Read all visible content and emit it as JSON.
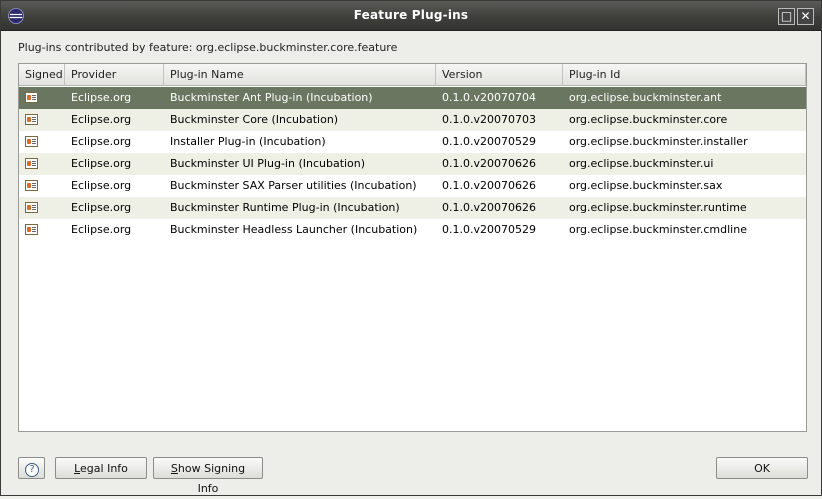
{
  "window": {
    "title": "Feature Plug-ins",
    "maximize_glyph": "□",
    "close_glyph": "✕"
  },
  "feature_label": "Plug-ins contributed by feature: org.eclipse.buckminster.core.feature",
  "table": {
    "columns": [
      "Signed",
      "Provider",
      "Plug-in Name",
      "Version",
      "Plug-in Id"
    ],
    "selected_row": 0,
    "rows": [
      {
        "provider": "Eclipse.org",
        "name": "Buckminster Ant Plug-in (Incubation)",
        "version": "0.1.0.v20070704",
        "id": "org.eclipse.buckminster.ant"
      },
      {
        "provider": "Eclipse.org",
        "name": "Buckminster Core (Incubation)",
        "version": "0.1.0.v20070703",
        "id": "org.eclipse.buckminster.core"
      },
      {
        "provider": "Eclipse.org",
        "name": "Installer Plug-in (Incubation)",
        "version": "0.1.0.v20070529",
        "id": "org.eclipse.buckminster.installer"
      },
      {
        "provider": "Eclipse.org",
        "name": "Buckminster UI Plug-in (Incubation)",
        "version": "0.1.0.v20070626",
        "id": "org.eclipse.buckminster.ui"
      },
      {
        "provider": "Eclipse.org",
        "name": "Buckminster SAX Parser utilities (Incubation)",
        "version": "0.1.0.v20070626",
        "id": "org.eclipse.buckminster.sax"
      },
      {
        "provider": "Eclipse.org",
        "name": "Buckminster Runtime Plug-in (Incubation)",
        "version": "0.1.0.v20070626",
        "id": "org.eclipse.buckminster.runtime"
      },
      {
        "provider": "Eclipse.org",
        "name": "Buckminster Headless Launcher (Incubation)",
        "version": "0.1.0.v20070529",
        "id": "org.eclipse.buckminster.cmdline"
      }
    ]
  },
  "buttons": {
    "help_glyph": "?",
    "legal_first": "L",
    "legal_rest": "egal Info",
    "signing_first": "S",
    "signing_rest": "how Signing Info",
    "ok": "OK"
  },
  "icons": {
    "app": "eclipse-icon",
    "signed": "certificate-icon",
    "help": "help-icon"
  }
}
